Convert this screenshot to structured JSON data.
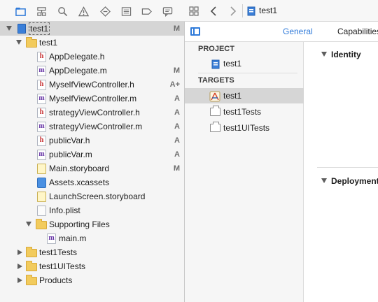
{
  "navigator": {
    "toolbar_icons": [
      "folder-icon",
      "hierarchy-icon",
      "search-icon",
      "warning-icon",
      "diamond-icon",
      "list-icon",
      "tag-icon",
      "comment-icon"
    ],
    "tree": [
      {
        "name": "test1",
        "status": "M",
        "kind": "project",
        "expanded": true,
        "selected": true
      },
      {
        "name": "test1",
        "status": "",
        "kind": "folder",
        "expanded": true
      },
      {
        "name": "AppDelegate.h",
        "status": "",
        "kind": "h"
      },
      {
        "name": "AppDelegate.m",
        "status": "M",
        "kind": "m"
      },
      {
        "name": "MyselfViewController.h",
        "status": "A+",
        "kind": "h"
      },
      {
        "name": "MyselfViewController.m",
        "status": "A",
        "kind": "m"
      },
      {
        "name": "strategyViewController.h",
        "status": "A",
        "kind": "h"
      },
      {
        "name": "strategyViewController.m",
        "status": "A",
        "kind": "m"
      },
      {
        "name": "publicVar.h",
        "status": "A",
        "kind": "h"
      },
      {
        "name": "publicVar.m",
        "status": "A",
        "kind": "m"
      },
      {
        "name": "Main.storyboard",
        "status": "M",
        "kind": "storyboard"
      },
      {
        "name": "Assets.xcassets",
        "status": "",
        "kind": "assets"
      },
      {
        "name": "LaunchScreen.storyboard",
        "status": "",
        "kind": "storyboard"
      },
      {
        "name": "Info.plist",
        "status": "",
        "kind": "plist"
      },
      {
        "name": "Supporting Files",
        "status": "",
        "kind": "folder",
        "expanded": true
      },
      {
        "name": "main.m",
        "status": "",
        "kind": "m"
      },
      {
        "name": "test1Tests",
        "status": "",
        "kind": "folder",
        "expanded": false
      },
      {
        "name": "test1UITests",
        "status": "",
        "kind": "folder",
        "expanded": false
      },
      {
        "name": "Products",
        "status": "",
        "kind": "folder",
        "expanded": false
      }
    ]
  },
  "editor": {
    "breadcrumb_file": "test1",
    "tabs": [
      "General",
      "Capabilities"
    ],
    "project_header": "PROJECT",
    "project_item": "test1",
    "targets_header": "TARGETS",
    "targets": [
      "test1",
      "test1Tests",
      "test1UITests"
    ],
    "sections": [
      "Identity",
      "Deployment"
    ]
  },
  "colors": {
    "accent": "#2f7ad9",
    "selection": "#d5d5d5",
    "header_file_red": "#c4282a",
    "impl_file_purple": "#6633a5",
    "folder_yellow": "#f2cb5d"
  }
}
